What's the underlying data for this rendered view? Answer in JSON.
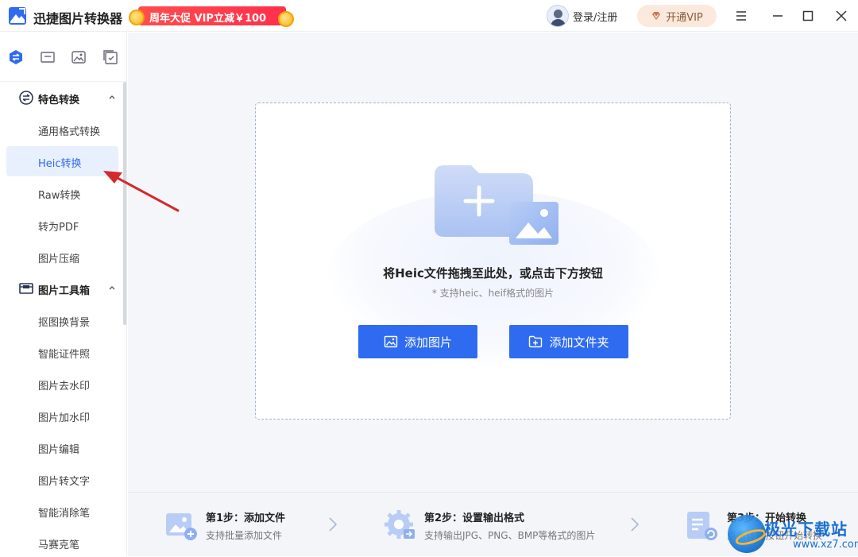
{
  "app": {
    "title": "迅捷图片转换器"
  },
  "promo": {
    "text": "周年大促 VIP立减￥100"
  },
  "header": {
    "login_label": "登录/注册",
    "vip_label": "开通VIP"
  },
  "sidebar": {
    "groups": [
      {
        "label": "特色转换",
        "items": [
          "通用格式转换",
          "Heic转换",
          "Raw转换",
          "转为PDF",
          "图片压缩"
        ]
      },
      {
        "label": "图片工具箱",
        "items": [
          "抠图换背景",
          "智能证件照",
          "图片去水印",
          "图片加水印",
          "图片编辑",
          "图片转文字",
          "智能消除笔",
          "马赛克笔"
        ]
      }
    ],
    "active_item": "Heic转换"
  },
  "dropzone": {
    "title": "将Heic文件拖拽至此处，或点击下方按钮",
    "subtitle": "* 支持heic、heif格式的图片",
    "add_image_label": "添加图片",
    "add_folder_label": "添加文件夹"
  },
  "steps": [
    {
      "title": "第1步：添加文件",
      "desc": "支持批量添加文件"
    },
    {
      "title": "第2步：设置输出格式",
      "desc": "支持输出JPG、PNG、BMP等格式的图片"
    },
    {
      "title": "第3步：开始转换",
      "desc": "点击转换按钮开始转换"
    }
  ],
  "watermark": {
    "title": "极光下载站",
    "url": "www.xz7.com"
  },
  "colors": {
    "accent": "#2f6bf0",
    "promo": "#ff3b4c",
    "vip_bg": "#fbe9dd"
  }
}
